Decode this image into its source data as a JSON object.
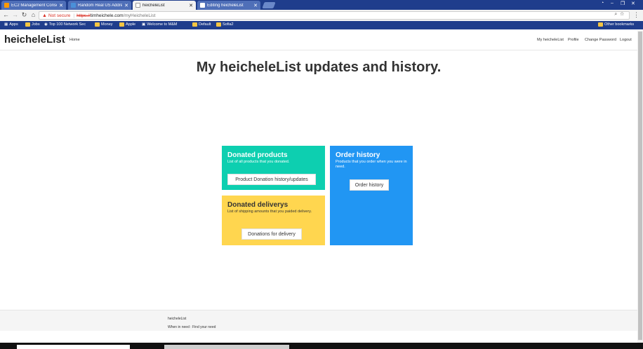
{
  "browser": {
    "tabs": [
      {
        "label": "EC2 Management Conso",
        "active": false,
        "color": "#ff9900"
      },
      {
        "label": "Random Real US Addres",
        "active": false,
        "color": "#4a90d9"
      },
      {
        "label": "heicheleList",
        "active": true,
        "color": "#ffffff"
      },
      {
        "label": "Editing heicheleList",
        "active": false,
        "color": "#ffffff"
      }
    ],
    "tab_close_glyph": "✕",
    "omnibox": {
      "not_secure": "Not secure",
      "url_proto": "https://",
      "url_host": "timheichele.com",
      "url_path": "/myHeicheleList"
    },
    "bookmarks": [
      {
        "label": "Apps",
        "icon": "grid-icon"
      },
      {
        "label": "Jobs",
        "icon": "folder-icon"
      },
      {
        "label": "Top 100 Network Sec",
        "icon": "eye-icon"
      },
      {
        "label": "Money",
        "icon": "folder-icon"
      },
      {
        "label": "Apple",
        "icon": "folder-icon"
      },
      {
        "label": "Welcome to M&M",
        "icon": "page-icon"
      },
      {
        "label": "Default",
        "icon": "folder-icon"
      },
      {
        "label": "Sofia2",
        "icon": "folder-icon"
      },
      {
        "label": "Other bookmarks",
        "icon": "folder-icon"
      }
    ]
  },
  "navbar": {
    "brand": "heicheleList",
    "home": "Home",
    "links": [
      "My heicheleList",
      "Profile",
      "Change Password",
      "Logout"
    ]
  },
  "main": {
    "heading": "My heicheleList updates and history."
  },
  "cards": {
    "donated": {
      "title": "Donated products",
      "text": "List of all products that you donated.",
      "button": "Product Donation history/updates",
      "color": "#0dcfb0"
    },
    "delivery": {
      "title": "Donated deliverys",
      "text": "List of shipping amounts that you paided delivery.",
      "button": "Donations for delivery",
      "color": "#ffd64f"
    },
    "orders": {
      "title": "Order history",
      "text": "Products that you order when you were in need.",
      "button": "Order history",
      "color": "#2196f3"
    }
  },
  "footer": {
    "name": "heicheleList",
    "tagline": "When in need : Find your need"
  }
}
